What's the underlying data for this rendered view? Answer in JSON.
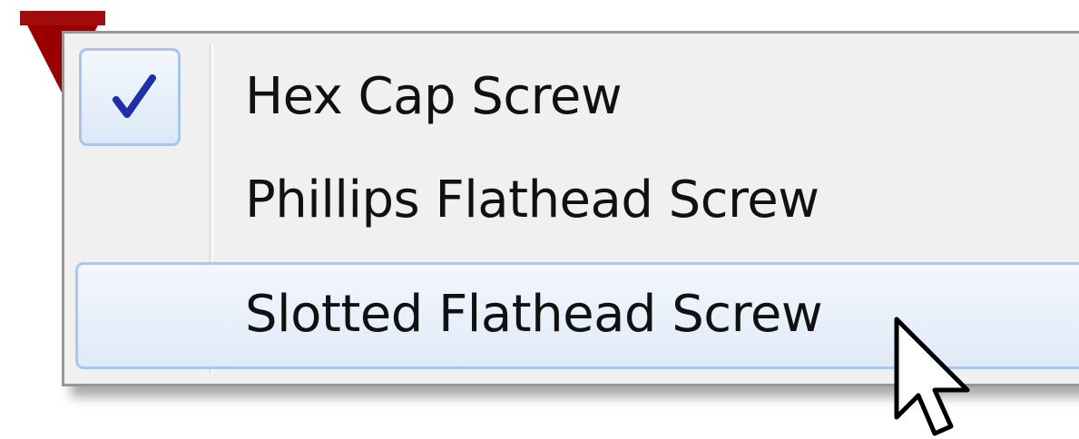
{
  "menu": {
    "items": [
      {
        "label": "Hex Cap Screw",
        "checked": true,
        "hovered": false
      },
      {
        "label": "Phillips Flathead Screw",
        "checked": false,
        "hovered": false
      },
      {
        "label": "Slotted Flathead Screw",
        "checked": false,
        "hovered": true
      }
    ]
  },
  "icons": {
    "check": "check-icon",
    "cursor": "mouse-pointer-icon",
    "marker": "red-triangle-marker"
  },
  "colors": {
    "marker": "#9b0000",
    "check": "#1e2fa8",
    "highlight_border": "#a8c8f0",
    "menu_background": "#f0f0f0"
  }
}
